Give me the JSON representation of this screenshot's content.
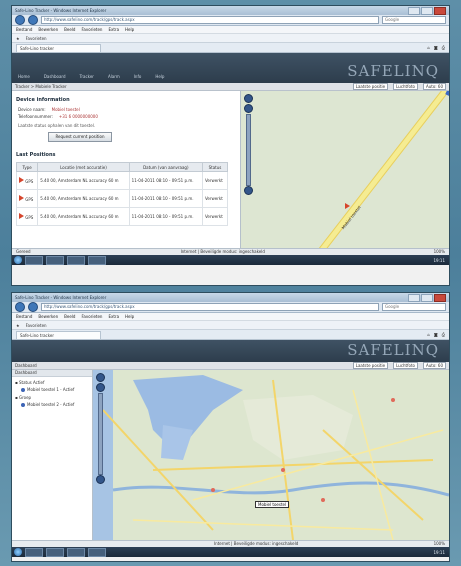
{
  "colors": {
    "header_bg": "#2d3d4c",
    "map_land": "#d9e4cd",
    "water": "#9bbbe3",
    "road": "#f3e77a",
    "flag": "#d6452c"
  },
  "panels": [
    {
      "browser_title": "Safe-Lino Tracker - Windows Internet Explorer",
      "url": "http://www.safelino.com/track/gps/track.aspx",
      "search_placeholder": "Google",
      "menu": [
        "Bestand",
        "Bewerken",
        "Beeld",
        "Favorieten",
        "Extra",
        "Help"
      ],
      "favorites_label": "Favorieten",
      "tab_title": "Safe-Lino tracker",
      "app_nav": [
        "Home",
        "Dashboard",
        "Tracker",
        "Alarm",
        "Info",
        "Help"
      ],
      "logo": "SAFELINQ",
      "breadcrumb": "Tracker > Mobiele Tracker",
      "controls": [
        "Laatste positie",
        "Luchtfoto",
        "Auto: 60"
      ],
      "section_title": "Device information",
      "kv": [
        {
          "k": "Device naam:",
          "v": "Mobiel toestel"
        },
        {
          "k": "Telefoonnummer:",
          "v": "+31 6 0000000000"
        }
      ],
      "note": "Laatste status ophalen van dit toestel.",
      "request_button": "Request current position",
      "last_title": "Last Positions",
      "table_headers": [
        "Type",
        "Locatie (met accuratie)",
        "Datum (van aanvraag)",
        "Status"
      ],
      "rows": [
        {
          "type": "GPS",
          "loc": "5.40 00, Amsterdam NL accuracy 60 m",
          "date": "11-04-2011 08:10 - 09:51 p.m.",
          "status": "Verwerkt"
        },
        {
          "type": "GPS",
          "loc": "5.40 00, Amsterdam NL accuracy 60 m",
          "date": "11-04-2011 08:10 - 09:51 p.m.",
          "status": "Verwerkt"
        },
        {
          "type": "GPS",
          "loc": "5.40 00, Amsterdam NL accuracy 60 m",
          "date": "11-04-2011 08:10 - 09:51 p.m.",
          "status": "Verwerkt"
        }
      ],
      "status_left": "Gereed",
      "status_center": "Internet | Beveiligde modus: ingeschakeld",
      "status_zoom": "100%",
      "clock": "19:11",
      "map_marker": "Mobiel toestel"
    },
    {
      "browser_title": "Safe-Lino Tracker - Windows Internet Explorer",
      "url": "http://www.safelino.com/track/gps/track.aspx",
      "search_placeholder": "Google",
      "menu": [
        "Bestand",
        "Bewerken",
        "Beeld",
        "Favorieten",
        "Extra",
        "Help"
      ],
      "favorites_label": "Favorieten",
      "tab_title": "Safe-Lino tracker",
      "logo": "SAFELINQ",
      "breadcrumb": "Dashboard",
      "controls": [
        "Laatste positie",
        "Luchtfoto",
        "Auto: 60"
      ],
      "tree_header": "Dashboard",
      "tree_groups": [
        {
          "label": "Status Actief",
          "items": [
            "Mobiel toestel 1 - Actief"
          ]
        },
        {
          "label": "Groep",
          "items": [
            "Mobiel toestel 2 - Actief"
          ]
        }
      ],
      "map_marker": "Mobiel toestel",
      "status_center": "Internet | Beveiligde modus: ingeschakeld",
      "status_zoom": "100%",
      "clock": "19:11"
    }
  ]
}
